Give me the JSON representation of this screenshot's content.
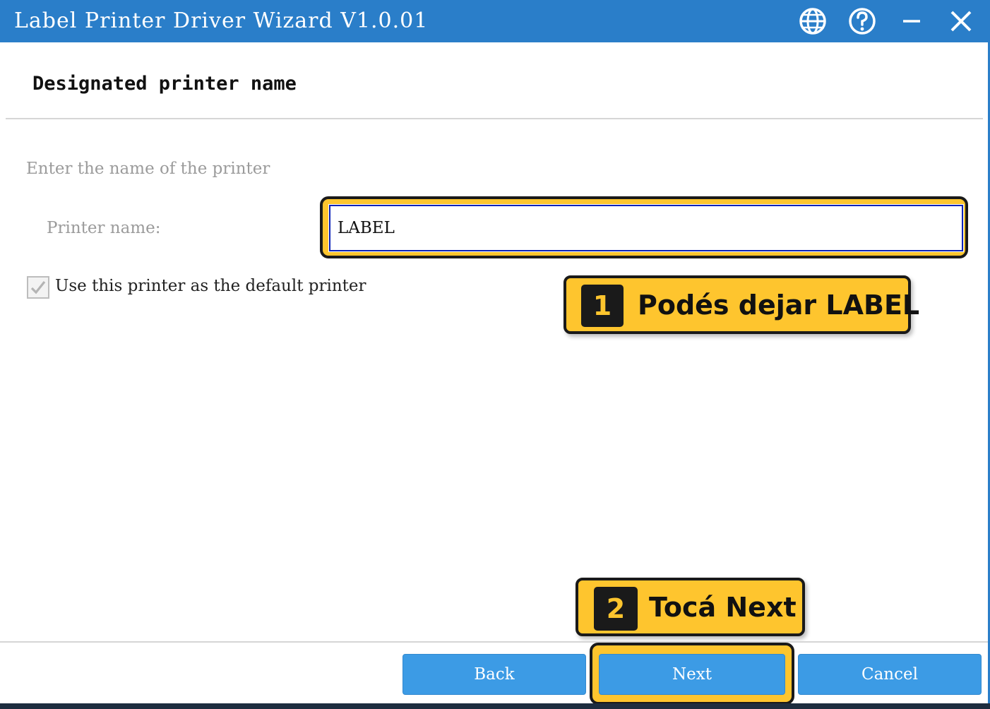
{
  "window": {
    "title": "Label Printer Driver Wizard  V1.0.01",
    "controls": {
      "language_icon": "globe-icon",
      "help_icon": "help-icon",
      "minimize_icon": "minimize-icon",
      "close_icon": "close-icon"
    }
  },
  "page": {
    "section_title": "Designated printer name",
    "instruction": "Enter the name of the printer",
    "printer_name_label": "Printer name:",
    "printer_name_value": "LABEL",
    "default_checkbox_label": "Use this printer as the default printer",
    "default_checked": true
  },
  "callouts": [
    {
      "number": "1",
      "text": "Podés dejar LABEL"
    },
    {
      "number": "2",
      "text": "Tocá Next"
    }
  ],
  "footer": {
    "back_label": "Back",
    "next_label": "Next",
    "cancel_label": "Cancel"
  },
  "colors": {
    "titlebar": "#2a7ec9",
    "button": "#3c9be5",
    "highlight": "#fec52e",
    "callout_border": "#1a1a1a"
  }
}
